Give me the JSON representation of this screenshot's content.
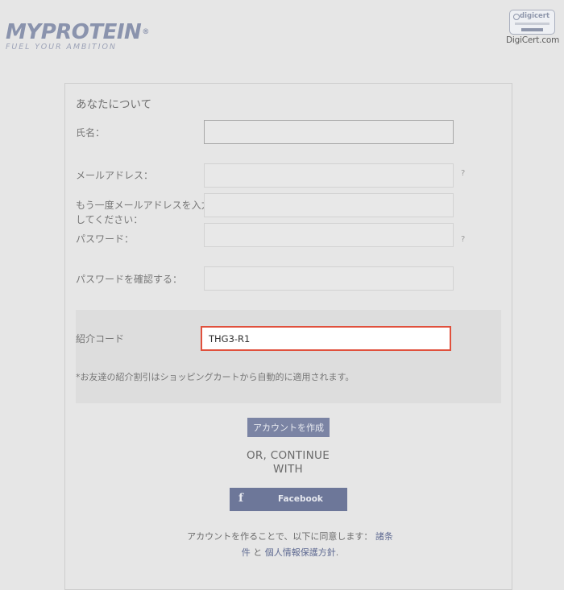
{
  "brand": {
    "name": "MYPROTEIN",
    "reg_mark": "®",
    "tagline": "FUEL YOUR AMBITION"
  },
  "seal": {
    "brand": "digicert",
    "caption": "DigiCert.com"
  },
  "form": {
    "section_title": "あなたについて",
    "fields": {
      "name_label": "氏名：",
      "name_value": "",
      "email_label": "メールアドレス：",
      "email_value": "",
      "email_confirm_label_line1": "もう一度メールアドレスを入力",
      "email_confirm_label_line2": "してください：",
      "email_confirm_value": "",
      "password_label": "パスワード：",
      "password_value": "",
      "password_confirm_label": "パスワードを確認する：",
      "password_confirm_value": ""
    },
    "help_icon": "?",
    "referral": {
      "label": "紹介コード",
      "value": "THG3-R1",
      "note": "*お友達の紹介割引はショッピングカートから自動的に適用されます。"
    },
    "create_account_label": "アカウントを作成",
    "or_continue_line1": "OR, CONTINUE",
    "or_continue_line2": "WITH",
    "facebook": {
      "icon": "facebook-icon",
      "glyph": "f",
      "label": "Facebook"
    },
    "terms": {
      "prefix": "アカウントを作ることで、以下に同意します：",
      "terms_link_a": "諸条",
      "terms_link_b": "件",
      "and": " と ",
      "privacy_link": "個人情報保護方針",
      "suffix": "."
    }
  },
  "colors": {
    "brand": "#8a93ad",
    "button": "#7b84a4",
    "facebook": "#6d7799",
    "highlight_border": "#e0503c"
  }
}
